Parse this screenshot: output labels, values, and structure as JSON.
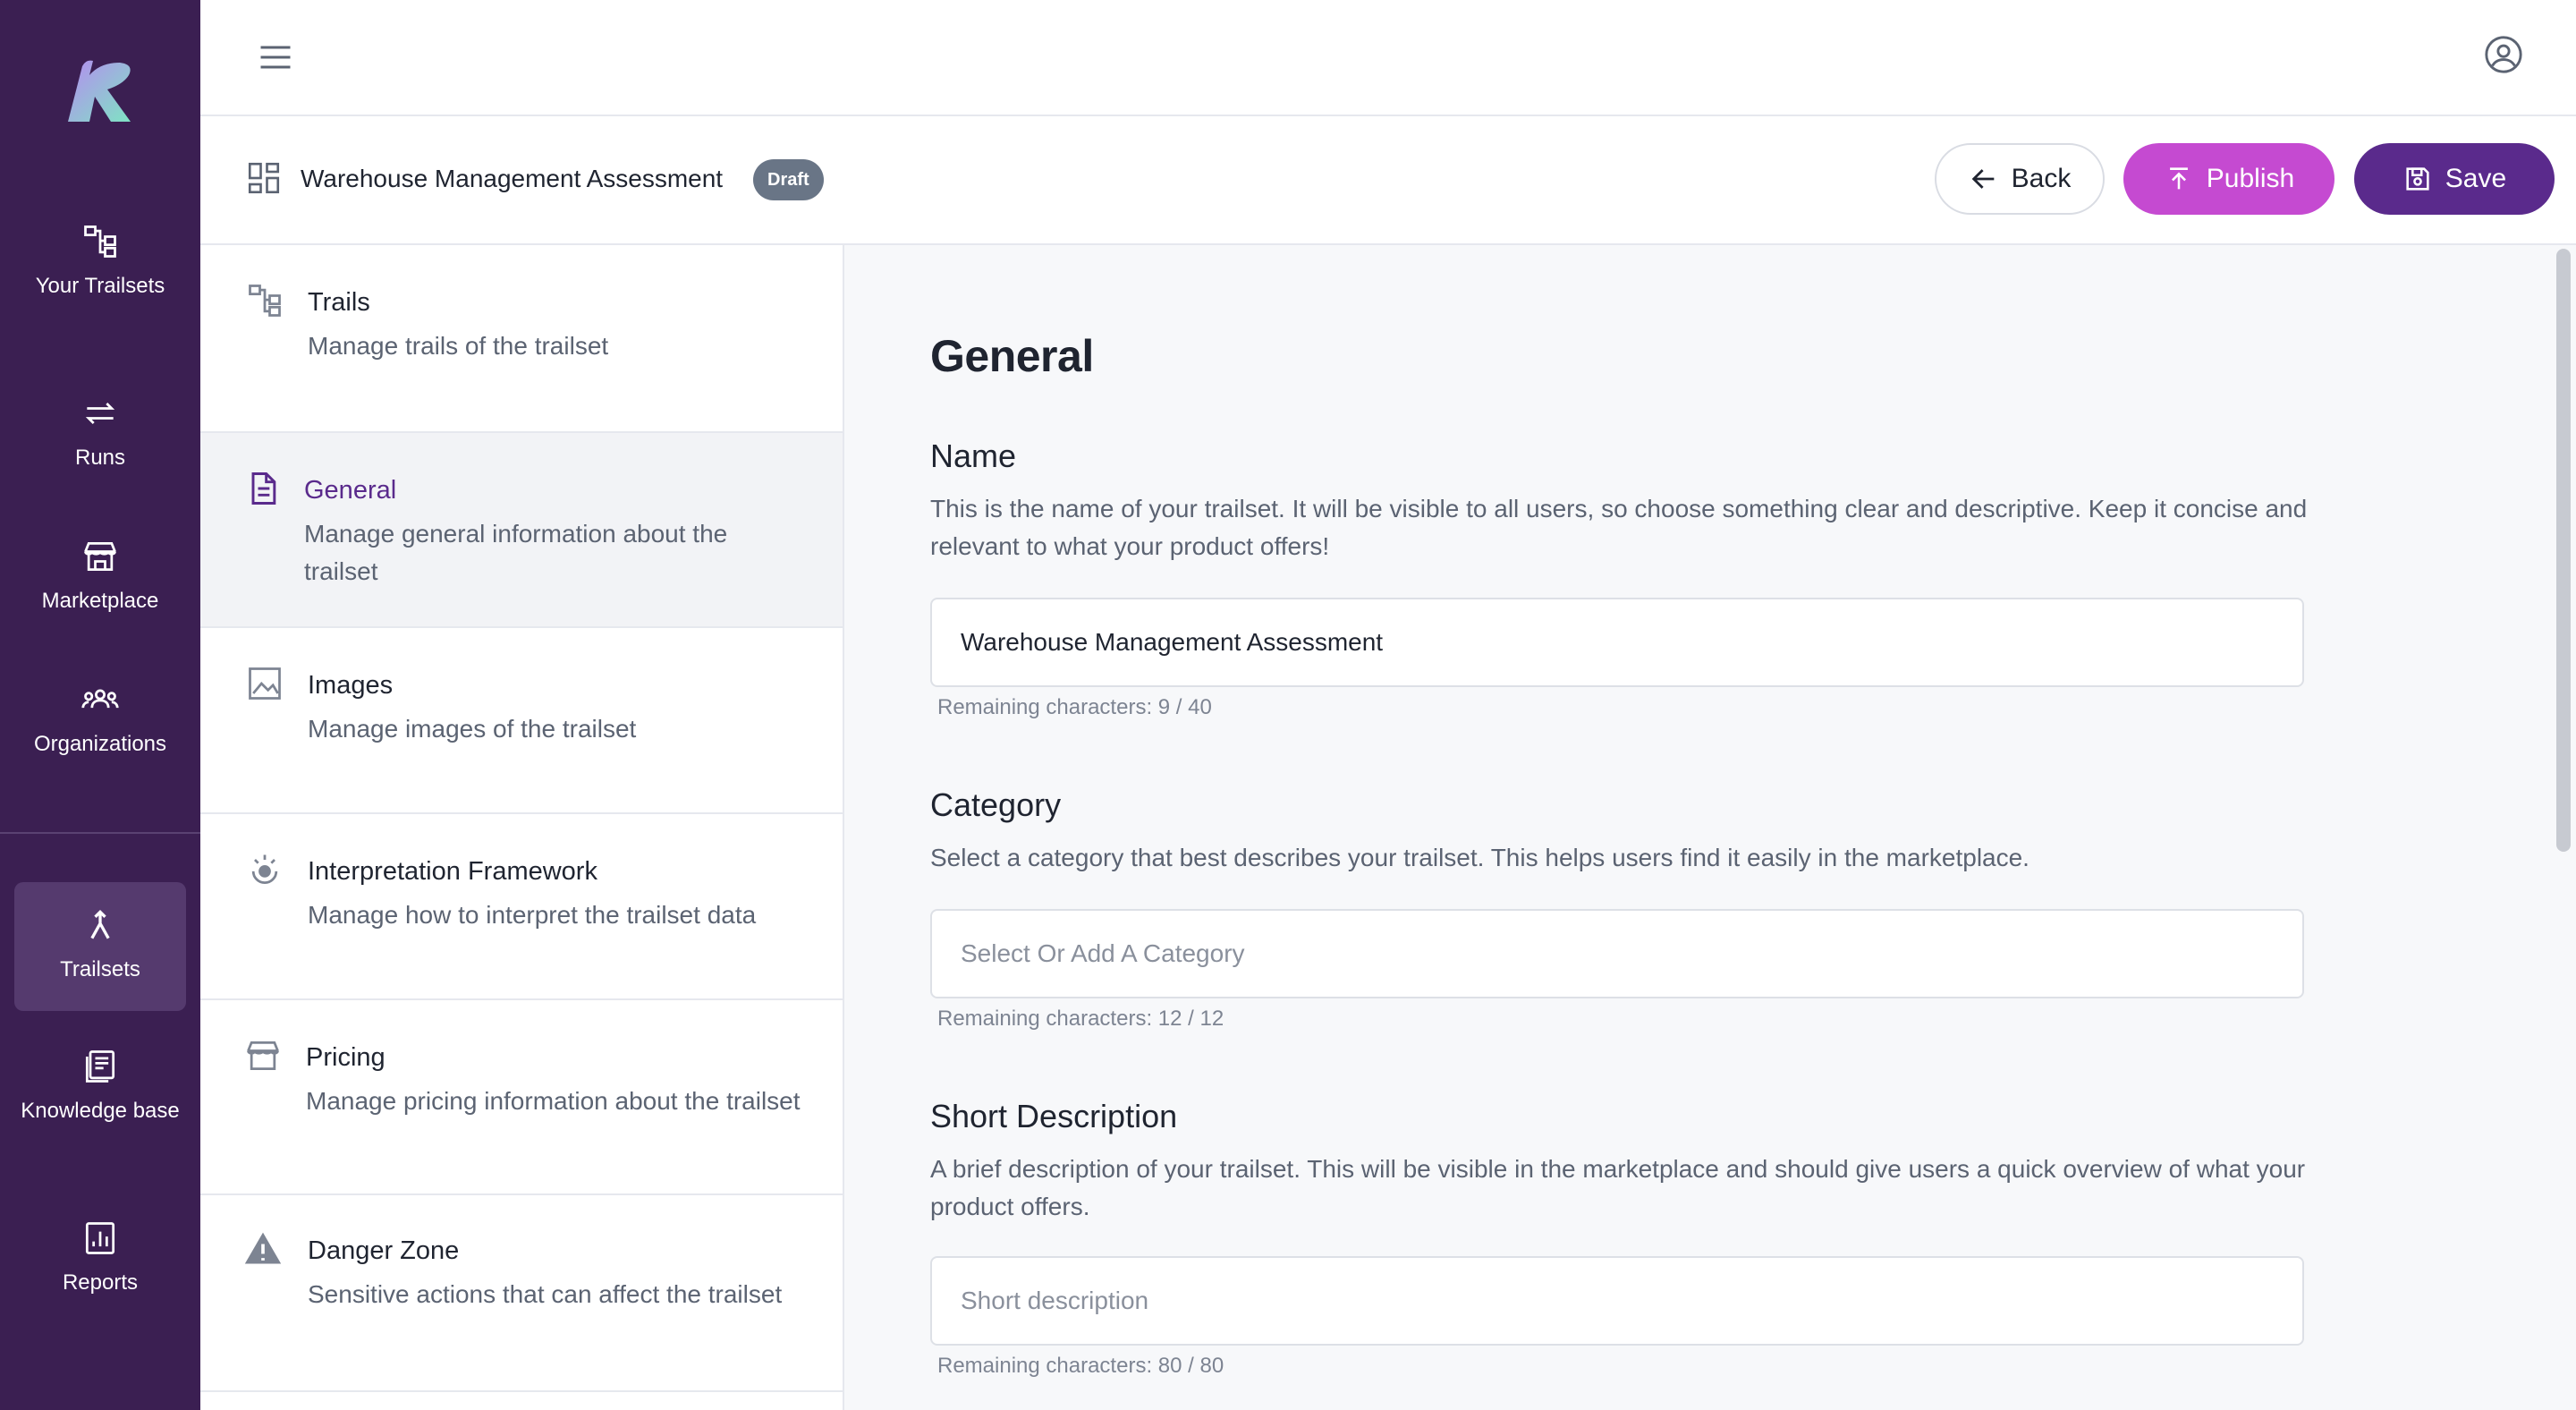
{
  "brand": {
    "logo": "K-logo",
    "primary": "#5a2a8c",
    "accent": "#c54ad1",
    "rail_bg": "#3b1f52"
  },
  "nav": {
    "items": [
      {
        "label": "Your Trailsets",
        "icon": "trails-icon"
      },
      {
        "label": "Runs",
        "icon": "runs-icon"
      },
      {
        "label": "Marketplace",
        "icon": "marketplace-icon"
      },
      {
        "label": "Organizations",
        "icon": "organizations-icon"
      },
      {
        "label": "Trailsets",
        "icon": "trailsets-icon",
        "active": true
      },
      {
        "label": "Knowledge base",
        "icon": "knowledge-base-icon"
      },
      {
        "label": "Reports",
        "icon": "reports-icon"
      }
    ]
  },
  "header": {
    "title": "Warehouse Management Assessment",
    "status_badge": "Draft",
    "back_label": "Back",
    "publish_label": "Publish",
    "save_label": "Save"
  },
  "settings_menu": [
    {
      "title": "Trails",
      "description": "Manage trails of the trailset",
      "icon": "trails-icon"
    },
    {
      "title": "General",
      "description": "Manage general information about the trailset",
      "icon": "document-icon",
      "active": true
    },
    {
      "title": "Images",
      "description": "Manage images of the trailset",
      "icon": "image-icon"
    },
    {
      "title": "Interpretation Framework",
      "description": "Manage how to interpret the trailset data",
      "icon": "interpretation-icon"
    },
    {
      "title": "Pricing",
      "description": "Manage pricing information about the trailset",
      "icon": "store-icon"
    },
    {
      "title": "Danger Zone",
      "description": "Sensitive actions that can affect the trailset",
      "icon": "warning-icon"
    }
  ],
  "main": {
    "heading": "General",
    "name": {
      "label": "Name",
      "description": "This is the name of your trailset. It will be visible to all users, so choose something clear and descriptive. Keep it concise and relevant to what your product offers!",
      "value": "Warehouse Management Assessment",
      "remaining": "Remaining characters: 9 / 40"
    },
    "category": {
      "label": "Category",
      "description": "Select a category that best describes your trailset. This helps users find it easily in the marketplace.",
      "placeholder": "Select Or Add A Category",
      "remaining": "Remaining characters: 12 / 12"
    },
    "short_description": {
      "label": "Short Description",
      "description": "A brief description of your trailset. This will be visible in the marketplace and should give users a quick overview of what your product offers.",
      "placeholder": "Short description",
      "remaining": "Remaining characters: 80 / 80"
    }
  }
}
